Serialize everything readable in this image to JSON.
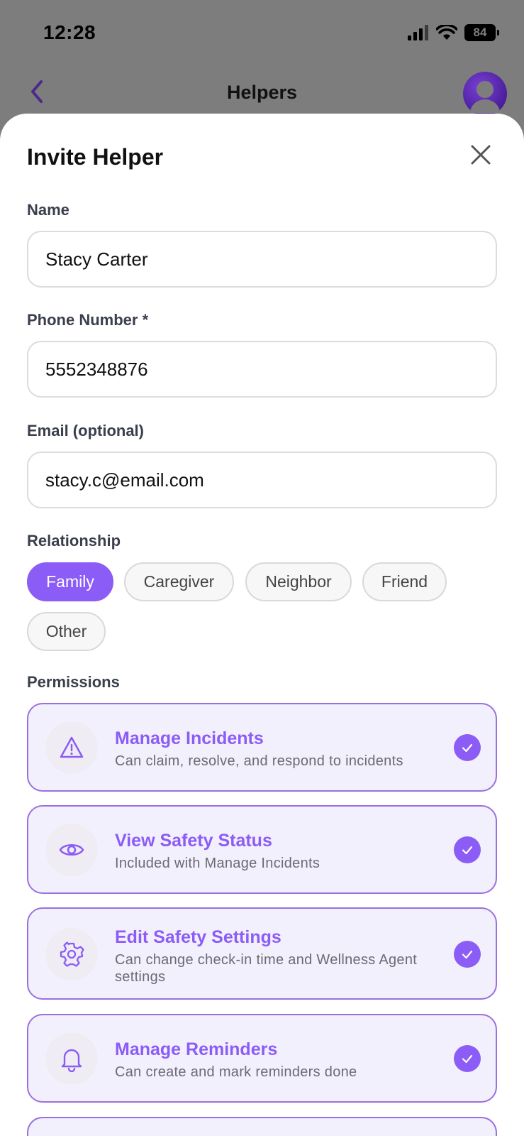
{
  "status_bar": {
    "time": "12:28",
    "battery": "84"
  },
  "nav": {
    "title": "Helpers"
  },
  "sheet": {
    "title": "Invite Helper",
    "fields": {
      "name": {
        "label": "Name",
        "value": "Stacy Carter"
      },
      "phone": {
        "label": "Phone Number *",
        "value": "5552348876"
      },
      "email": {
        "label": "Email (optional)",
        "value": "stacy.c@email.com"
      }
    },
    "relationship": {
      "label": "Relationship",
      "options": [
        "Family",
        "Caregiver",
        "Neighbor",
        "Friend",
        "Other"
      ],
      "selected": "Family"
    },
    "permissions": {
      "label": "Permissions",
      "items": [
        {
          "title": "Manage Incidents",
          "desc": "Can claim, resolve, and respond to incidents",
          "icon": "warning-icon",
          "checked": true
        },
        {
          "title": "View Safety Status",
          "desc": "Included with Manage Incidents",
          "icon": "eye-icon",
          "checked": true
        },
        {
          "title": "Edit Safety Settings",
          "desc": "Can change check-in time and Wellness Agent settings",
          "icon": "gear-icon",
          "checked": true
        },
        {
          "title": "Manage Reminders",
          "desc": "Can create and mark reminders done",
          "icon": "bell-icon",
          "checked": true
        }
      ]
    }
  },
  "colors": {
    "accent": "#8b5cf6",
    "accent_border": "#9b6fe0",
    "perm_bg": "#f3f0fd"
  }
}
